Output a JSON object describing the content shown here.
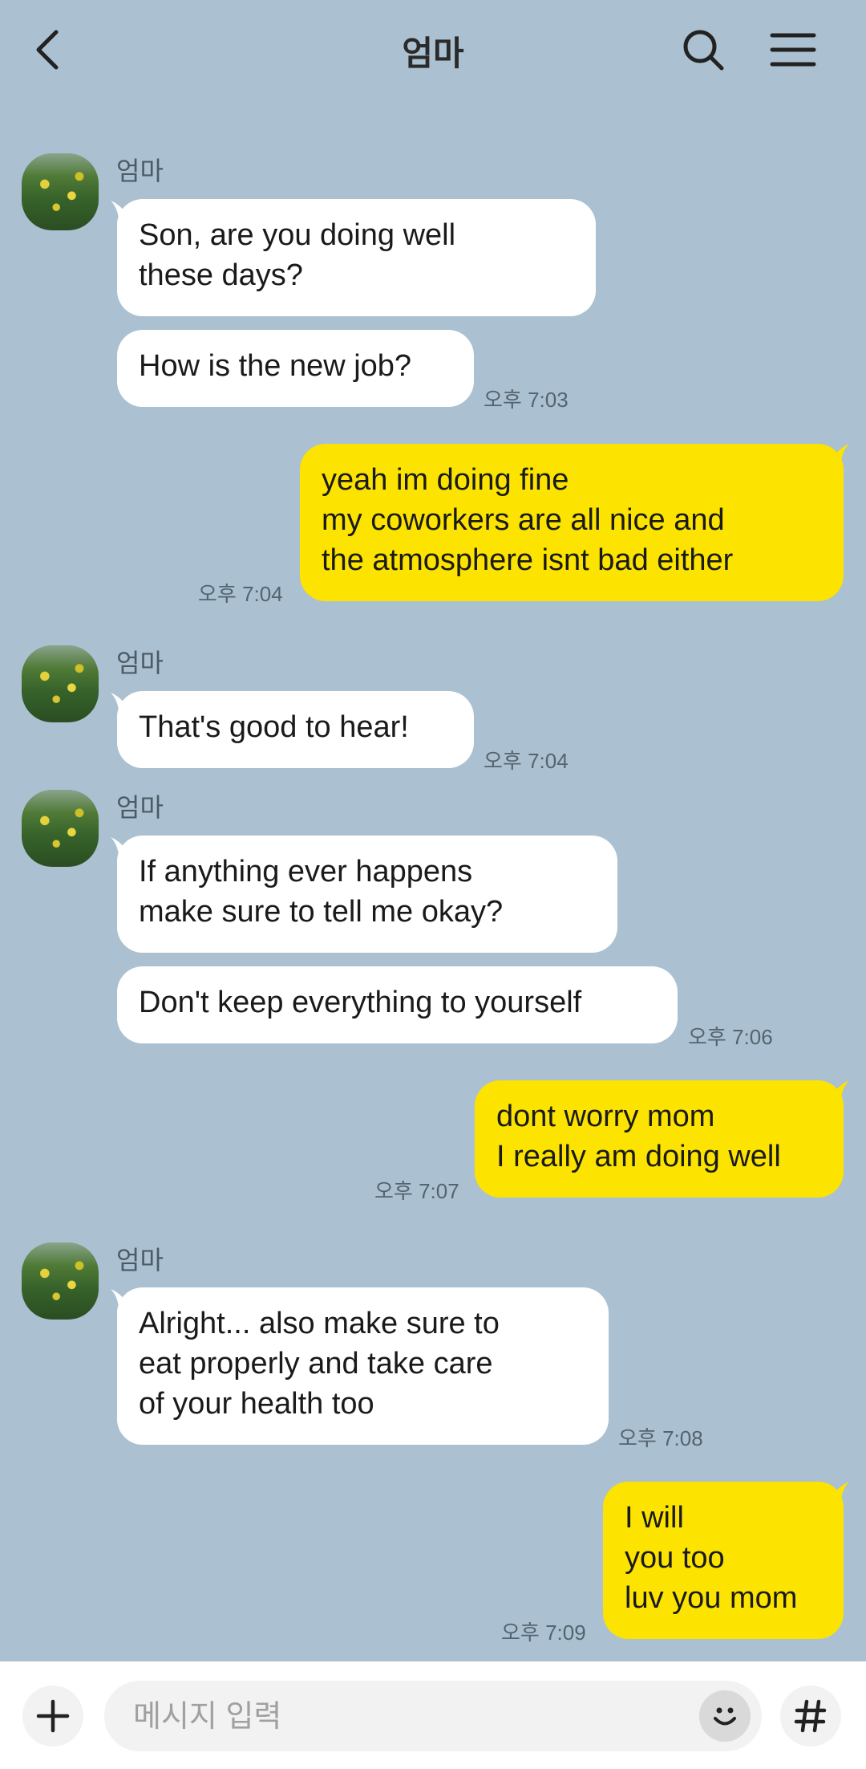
{
  "header": {
    "title": "엄마",
    "back_icon": "chevron-left-icon",
    "search_icon": "search-icon",
    "menu_icon": "menu-icon"
  },
  "colors": {
    "background": "#abc1d1",
    "incoming_bubble": "#ffffff",
    "outgoing_bubble": "#fce300"
  },
  "messages": [
    {
      "sender": "엄마",
      "lines": [
        "Son, are you doing well\nthese days?",
        "How is the new job?"
      ],
      "time": "오후 7:03"
    },
    {
      "sender": "me",
      "lines": [
        "yeah im doing fine\nmy coworkers are all nice and\nthe atmosphere isnt bad either"
      ],
      "time": "오후 7:04"
    },
    {
      "sender": "엄마",
      "lines": [
        "That's good to hear!"
      ],
      "time": "오후 7:04"
    },
    {
      "sender": "엄마",
      "lines": [
        "If anything ever happens\nmake sure to tell me okay?",
        "Don't keep everything to yourself"
      ],
      "time": "오후 7:06"
    },
    {
      "sender": "me",
      "lines": [
        "dont worry mom\nI really am doing well"
      ],
      "time": "오후 7:07"
    },
    {
      "sender": "엄마",
      "lines": [
        "Alright... also make sure to\neat properly and take care\nof your health too"
      ],
      "time": "오후 7:08"
    },
    {
      "sender": "me",
      "lines": [
        "I will\nyou too\nluv you mom"
      ],
      "time": "오후 7:09"
    }
  ],
  "input": {
    "placeholder": "메시지 입력",
    "plus_icon": "plus-icon",
    "emoji_icon": "emoji-icon",
    "hash_icon": "hash-icon"
  }
}
